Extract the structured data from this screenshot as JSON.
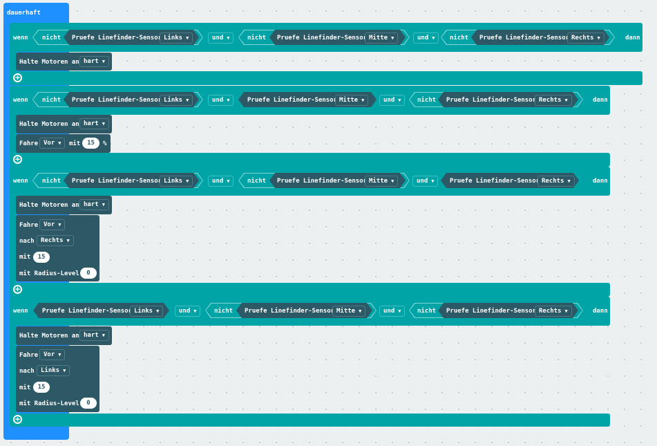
{
  "colors": {
    "event": "#1e90ff",
    "logic": "#00a4a6",
    "motor": "#2d5967",
    "workspace": "#ecf0f1"
  },
  "forever": {
    "label": "dauerhaft"
  },
  "common": {
    "wenn": "wenn",
    "dann": "dann",
    "nicht": "nicht",
    "und": "und",
    "sensor": "Pruefe Linefinder-Sensor",
    "halte": "Halte Motoren an",
    "hart": "hart",
    "fahre": "Fahre",
    "vor": "Vor",
    "mit": "mit",
    "nach": "nach",
    "radius": "mit Radius-Level",
    "percent": "%"
  },
  "sides": {
    "links": "Links",
    "mitte": "Mitte",
    "rechts": "Rechts"
  },
  "blocks": [
    {
      "speed": "15"
    },
    {
      "speed": "15",
      "turn": "Rechts",
      "radius": "0"
    },
    {
      "speed": "15",
      "turn": "Links",
      "radius": "0"
    }
  ],
  "icons": {
    "dropdown": "▼",
    "add": "+"
  }
}
